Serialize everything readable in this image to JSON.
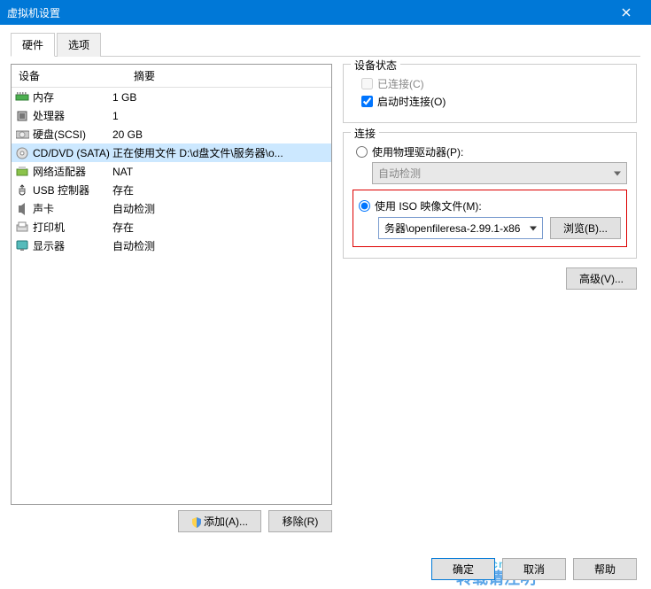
{
  "window": {
    "title": "虚拟机设置"
  },
  "tabs": {
    "hardware": "硬件",
    "options": "选项"
  },
  "columns": {
    "device": "设备",
    "summary": "摘要"
  },
  "devices": [
    {
      "name": "内存",
      "summary": "1 GB"
    },
    {
      "name": "处理器",
      "summary": "1"
    },
    {
      "name": "硬盘(SCSI)",
      "summary": "20 GB"
    },
    {
      "name": "CD/DVD (SATA)",
      "summary": "正在使用文件 D:\\d盘文件\\服务器\\o..."
    },
    {
      "name": "网络适配器",
      "summary": "NAT"
    },
    {
      "name": "USB 控制器",
      "summary": "存在"
    },
    {
      "name": "声卡",
      "summary": "自动检测"
    },
    {
      "name": "打印机",
      "summary": "存在"
    },
    {
      "name": "显示器",
      "summary": "自动检测"
    }
  ],
  "buttons": {
    "add": "添加(A)...",
    "remove": "移除(R)",
    "browse": "浏览(B)...",
    "advanced": "高级(V)...",
    "ok": "确定",
    "cancel": "取消",
    "help": "帮助"
  },
  "groups": {
    "device_status": "设备状态",
    "connected": "已连接(C)",
    "connect_at_power": "启动时连接(O)",
    "connection": "连接",
    "use_physical": "使用物理驱动器(P):",
    "auto_detect": "自动检测",
    "use_iso": "使用 ISO 映像文件(M):",
    "iso_path": "务器\\openfileresa-2.99.1-x86"
  },
  "watermark": {
    "text": "www.cncrq.com",
    "sub": "转载请注明"
  }
}
